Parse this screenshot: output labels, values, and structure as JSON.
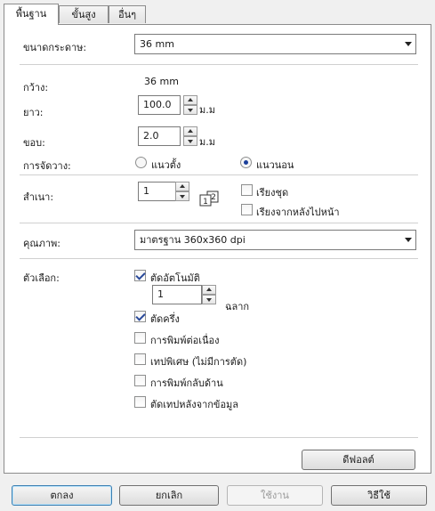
{
  "tabs": [
    "พื้นฐาน",
    "ขั้นสูง",
    "อื่นๆ"
  ],
  "labels": {
    "paper_size": "ขนาดกระดาษ:",
    "width": "กว้าง:",
    "length": "ยาว:",
    "margin": "ขอบ:",
    "orientation": "การจัดวาง:",
    "copies": "สำเนา:",
    "quality": "คุณภาพ:",
    "options": "ตัวเลือก:"
  },
  "paper_size": "36 mm",
  "width_value": "36 mm",
  "length": {
    "value": "100.0",
    "unit": "ม.ม"
  },
  "margin": {
    "value": "2.0",
    "unit": "ม.ม"
  },
  "orientation": {
    "portrait": "แนวตั้ง",
    "landscape": "แนวนอน",
    "selected": "landscape"
  },
  "copies": {
    "value": "1",
    "collate_icon": "collate-icon",
    "collate_icon_digits": [
      "1",
      "2"
    ],
    "collate": "เรียงชุด",
    "reverse": "เรียงจากหลังไปหน้า"
  },
  "quality": "มาตรฐาน 360x360 dpi",
  "options": {
    "auto_cut": {
      "label": "ตัดอัตโนมัติ",
      "checked": true
    },
    "every": {
      "value": "1",
      "unit": "ฉลาก"
    },
    "half_cut": {
      "label": "ตัดครึ่ง",
      "checked": true
    },
    "chain_print": {
      "label": "การพิมพ์ต่อเนื่อง",
      "checked": false
    },
    "special_tape": {
      "label": "เทปพิเศษ (ไม่มีการตัด)",
      "checked": false
    },
    "mirror_print": {
      "label": "การพิมพ์กลับด้าน",
      "checked": false
    },
    "cut_after_data": {
      "label": "ตัดเทปหลังจากข้อมูล",
      "checked": false
    }
  },
  "buttons": {
    "default": "ดีฟอลต์",
    "ok": "ตกลง",
    "cancel": "ยกเลิก",
    "apply": "ใช้งาน",
    "help": "วิธีใช้"
  }
}
